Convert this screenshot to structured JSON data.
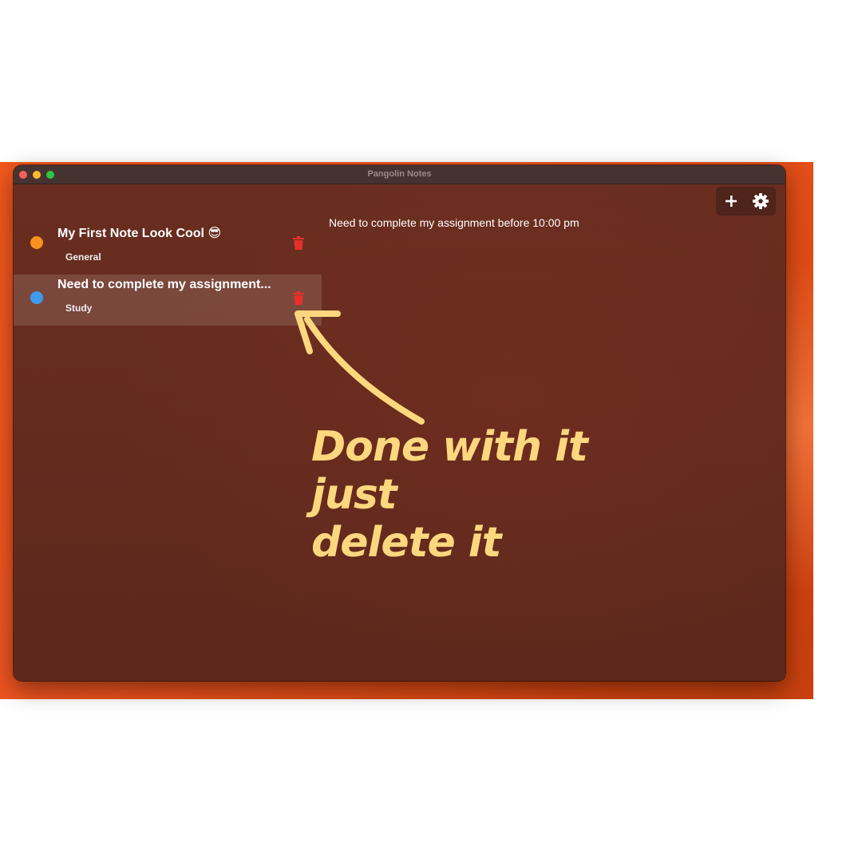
{
  "window": {
    "title": "Pangolin Notes"
  },
  "toolbar": {
    "add_icon": "plus-icon",
    "settings_icon": "gear-icon"
  },
  "notes": [
    {
      "title": "My First Note Look Cool 😎",
      "tag": "General",
      "color": "#f7921e",
      "selected": false
    },
    {
      "title": "Need to complete my assignment...",
      "tag": "Study",
      "color": "#3d9bee",
      "selected": true
    }
  ],
  "detail": {
    "text": "Need to complete my assignment before 10:00 pm"
  },
  "annotation": {
    "line1": "Done with it just",
    "line2": "delete it",
    "color": "#fdd77e"
  },
  "colors": {
    "delete": "#e8302b",
    "window_bg": "#652b1e",
    "desktop": "#ee5420"
  }
}
